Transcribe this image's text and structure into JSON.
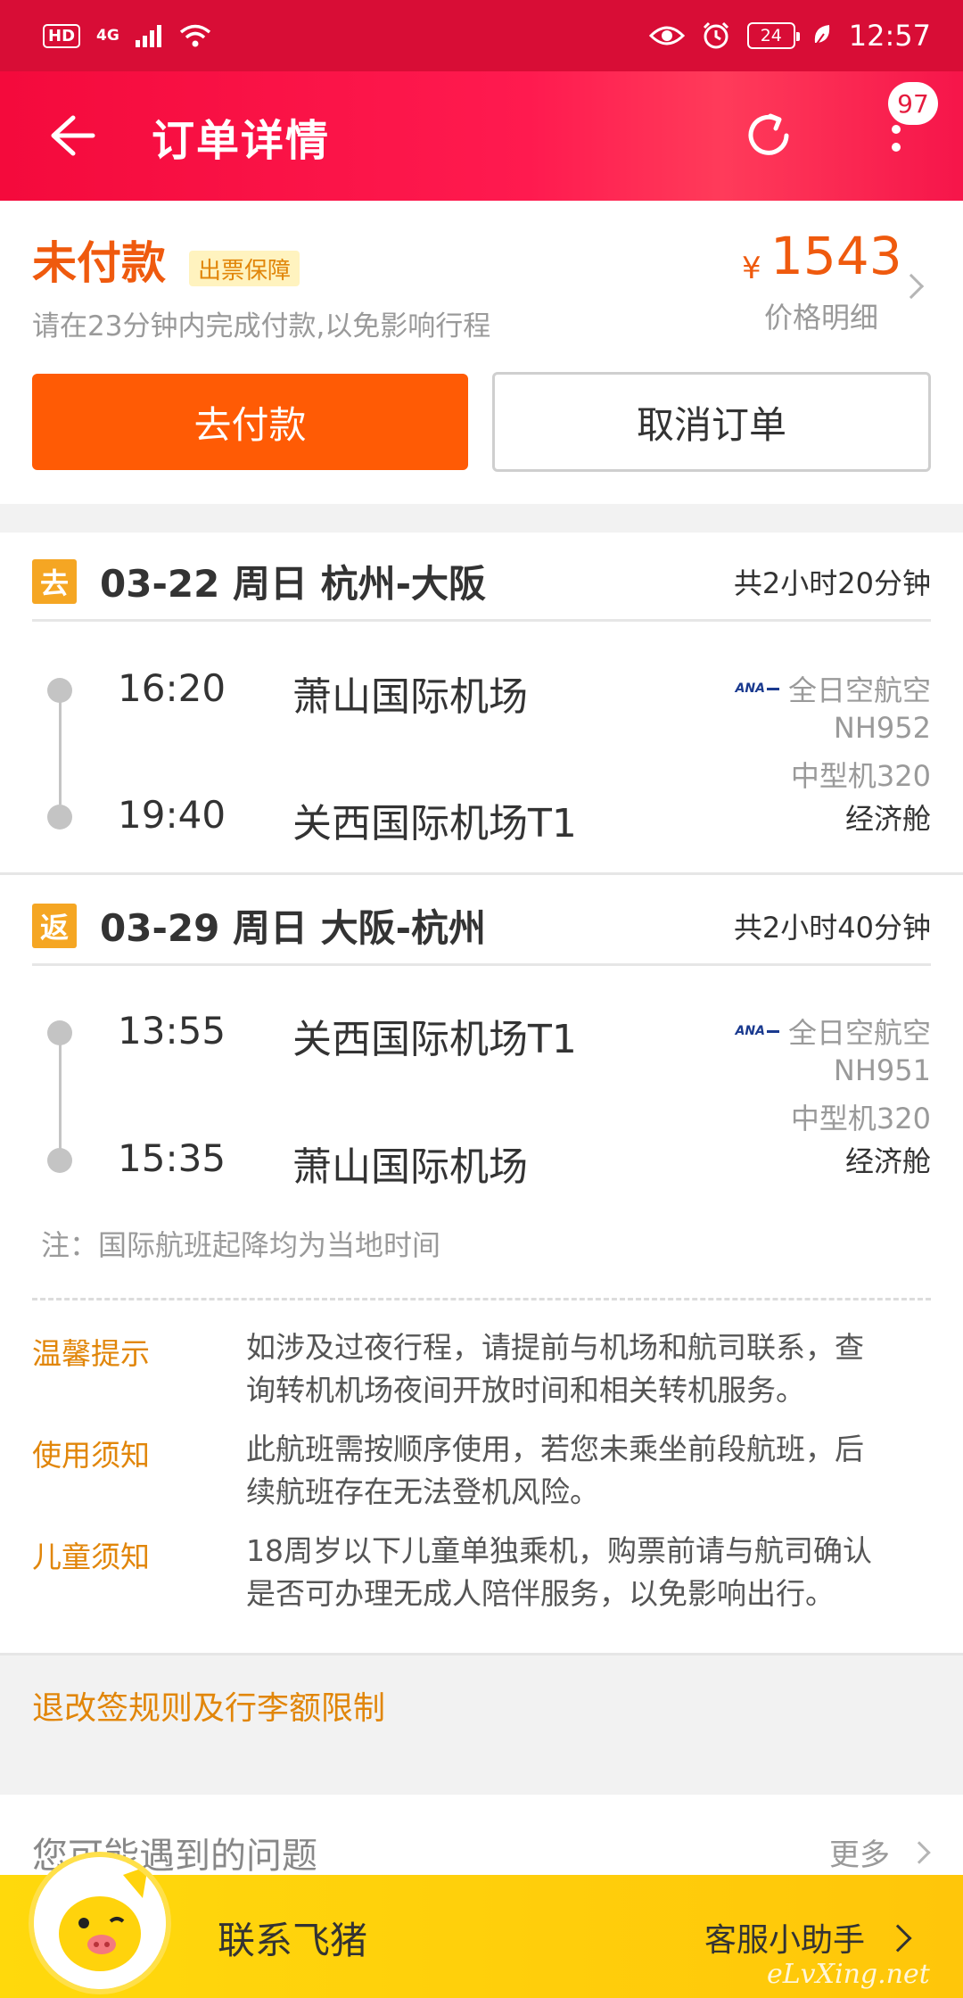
{
  "status_bar": {
    "hd": "HD",
    "network": "4G",
    "battery": "24",
    "time": "12:57"
  },
  "header": {
    "title": "订单详情",
    "badge": "97"
  },
  "payment": {
    "status": "未付款",
    "guarantee_tag": "出票保障",
    "tip": "请在23分钟内完成付款,以免影响行程",
    "currency": "¥",
    "price": "1543",
    "price_detail": "价格明细",
    "pay_button": "去付款",
    "cancel_button": "取消订单"
  },
  "segments": [
    {
      "tag": "去",
      "title": "03-22 周日 杭州-大阪",
      "duration": "共2小时20分钟",
      "depart_time": "16:20",
      "depart_airport": "萧山国际机场",
      "arrive_time": "19:40",
      "arrive_airport": "关西国际机场T1",
      "airline_logo": "ANA",
      "airline": "全日空航空",
      "flight_no": "NH952",
      "aircraft": "中型机320",
      "cabin": "经济舱"
    },
    {
      "tag": "返",
      "title": "03-29 周日 大阪-杭州",
      "duration": "共2小时40分钟",
      "depart_time": "13:55",
      "depart_airport": "关西国际机场T1",
      "arrive_time": "15:35",
      "arrive_airport": "萧山国际机场",
      "airline_logo": "ANA",
      "airline": "全日空航空",
      "flight_no": "NH951",
      "aircraft": "中型机320",
      "cabin": "经济舱"
    }
  ],
  "note": "注：国际航班起降均为当地时间",
  "tips": [
    {
      "label": "温馨提示",
      "lines": [
        "如涉及过夜行程，请提前与机场和航司联系，查",
        "询转机机场夜间开放时间和相关转机服务。"
      ]
    },
    {
      "label": "使用须知",
      "lines": [
        "此航班需按顺序使用，若您未乘坐前段航班，后",
        "续航班存在无法登机风险。"
      ]
    },
    {
      "label": "儿童须知",
      "lines": [
        "18周岁以下儿童单独乘机，购票前请与航司确认",
        "是否可办理无成人陪伴服务，以免影响出行。"
      ]
    }
  ],
  "rules_link": "退改签规则及行李额限制",
  "faq": {
    "title": "您可能遇到的问题",
    "more": "更多"
  },
  "bottom_bar": {
    "contact": "联系飞猪",
    "assistant": "客服小助手",
    "watermark": "eLvXing.net"
  },
  "colors": {
    "header_red": "#f40a3c",
    "accent_orange": "#ff5b05",
    "tag_amber": "#f5a623",
    "tip_orange": "#e1860a",
    "bottom_yellow": "#ffd90c"
  }
}
